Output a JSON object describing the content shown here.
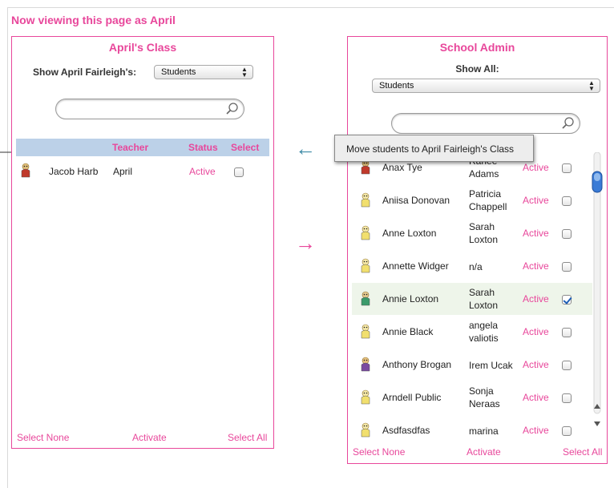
{
  "viewing_text": "Now viewing this page as April",
  "colors": {
    "accent": "#e8479b",
    "header_bg": "#bcd1e8",
    "arrow_blue": "#3d8aa6"
  },
  "left_panel": {
    "title": "April's Class",
    "show_label": "Show April Fairleigh's:",
    "show_select": "Students",
    "search_placeholder": "",
    "columns": {
      "teacher": "Teacher",
      "status": "Status",
      "select": "Select"
    },
    "rows": [
      {
        "name": "Jacob Harb",
        "teacher": "April",
        "status": "Active",
        "checked": false,
        "avatar": "red-character-icon"
      }
    ],
    "footer": {
      "select_none": "Select None",
      "activate": "Activate",
      "select_all": "Select All"
    }
  },
  "right_panel": {
    "title": "School Admin",
    "show_label": "Show All:",
    "show_select": "Students",
    "search_placeholder": "",
    "rows": [
      {
        "name": "Anax Tye",
        "teacher1": "Ranee",
        "teacher2": "Adams",
        "status": "Active",
        "checked": false,
        "avatar": "red-character-icon"
      },
      {
        "name": "Aniisa Donovan",
        "teacher1": "Patricia",
        "teacher2": "Chappell",
        "status": "Active",
        "checked": false,
        "avatar": "yellow-character-icon"
      },
      {
        "name": "Anne Loxton",
        "teacher1": "Sarah",
        "teacher2": "Loxton",
        "status": "Active",
        "checked": false,
        "avatar": "yellow-character-icon"
      },
      {
        "name": "Annette Widger",
        "teacher1": "n/a",
        "teacher2": "",
        "status": "Active",
        "checked": false,
        "avatar": "yellow-character-icon"
      },
      {
        "name": "Annie Loxton",
        "teacher1": "Sarah",
        "teacher2": "Loxton",
        "status": "Active",
        "checked": true,
        "avatar": "green-character-icon"
      },
      {
        "name": "Annie Black",
        "teacher1": "angela",
        "teacher2": "valiotis",
        "status": "Active",
        "checked": false,
        "avatar": "yellow-character-icon"
      },
      {
        "name": "Anthony Brogan",
        "teacher1": "Irem Ucak",
        "teacher2": "",
        "status": "Active",
        "checked": false,
        "avatar": "purple-character-icon"
      },
      {
        "name": "Arndell Public",
        "teacher1": "Sonja",
        "teacher2": "Neraas",
        "status": "Active",
        "checked": false,
        "avatar": "yellow-character-icon"
      },
      {
        "name": "Asdfasdfas",
        "teacher1": "marina",
        "teacher2": "",
        "status": "Active",
        "checked": false,
        "avatar": "yellow-character-icon"
      }
    ],
    "footer": {
      "select_none": "Select None",
      "activate": "Activate",
      "select_all": "Select All"
    }
  },
  "tooltip": "Move students to April Fairleigh's Class",
  "arrows": {
    "left": "←",
    "right": "→"
  }
}
